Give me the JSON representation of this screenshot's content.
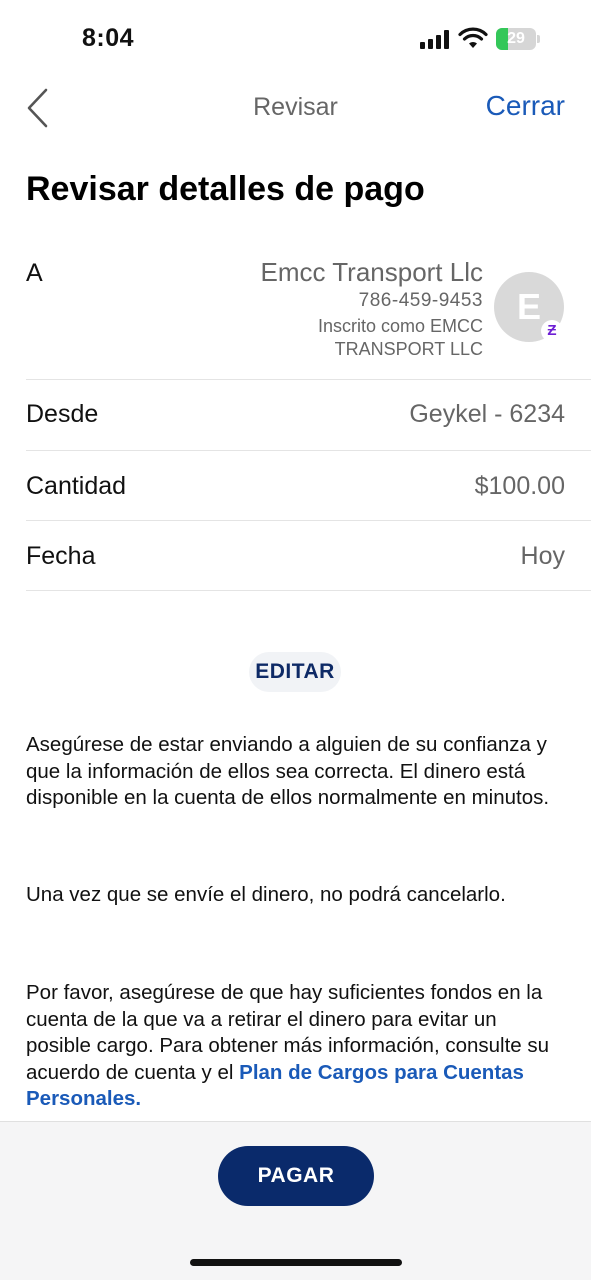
{
  "status_bar": {
    "time": "8:04",
    "battery_level": "29",
    "battery_fraction": 0.29,
    "icons": [
      "signal-icon",
      "wifi-icon",
      "battery-icon"
    ]
  },
  "nav": {
    "back_icon": "chevron-left-icon",
    "title": "Revisar",
    "close_label": "Cerrar"
  },
  "page_title": "Revisar detalles de pago",
  "recipient": {
    "label": "A",
    "name": "Emcc Transport Llc",
    "phone": "786-459-9453",
    "enrolled_as": "Inscrito como EMCC TRANSPORT LLC",
    "avatar_initial": "E",
    "badge_glyph": "Ƶ",
    "badge_icon": "zelle-icon"
  },
  "from": {
    "label": "Desde",
    "value": "Geykel - 6234"
  },
  "amount": {
    "label": "Cantidad",
    "value": "$100.00"
  },
  "date": {
    "label": "Fecha",
    "value": "Hoy"
  },
  "edit_label": "EDITAR",
  "disclaimers": {
    "p1": "Asegúrese de estar enviando a alguien de su confianza y que la información de ellos sea correcta. El dinero está disponible en la cuenta de ellos normalmente en minutos.",
    "p2": "Una vez que se envíe el dinero, no podrá cancelarlo.",
    "p3": "Por favor, asegúrese de que hay suficientes fondos en la cuenta de la que va a retirar el dinero para evitar un posible cargo. Para obtener más información, consulte su acuerdo de cuenta y el",
    "p3_link": "Plan de Cargos para Cuentas Personales",
    "p3_end": "."
  },
  "pay_label": "PAGAR",
  "colors": {
    "link_blue": "#1a5ab8",
    "navy": "#0a2a6b",
    "battery_green": "#34c759",
    "zelle_purple": "#6d1ed4"
  }
}
